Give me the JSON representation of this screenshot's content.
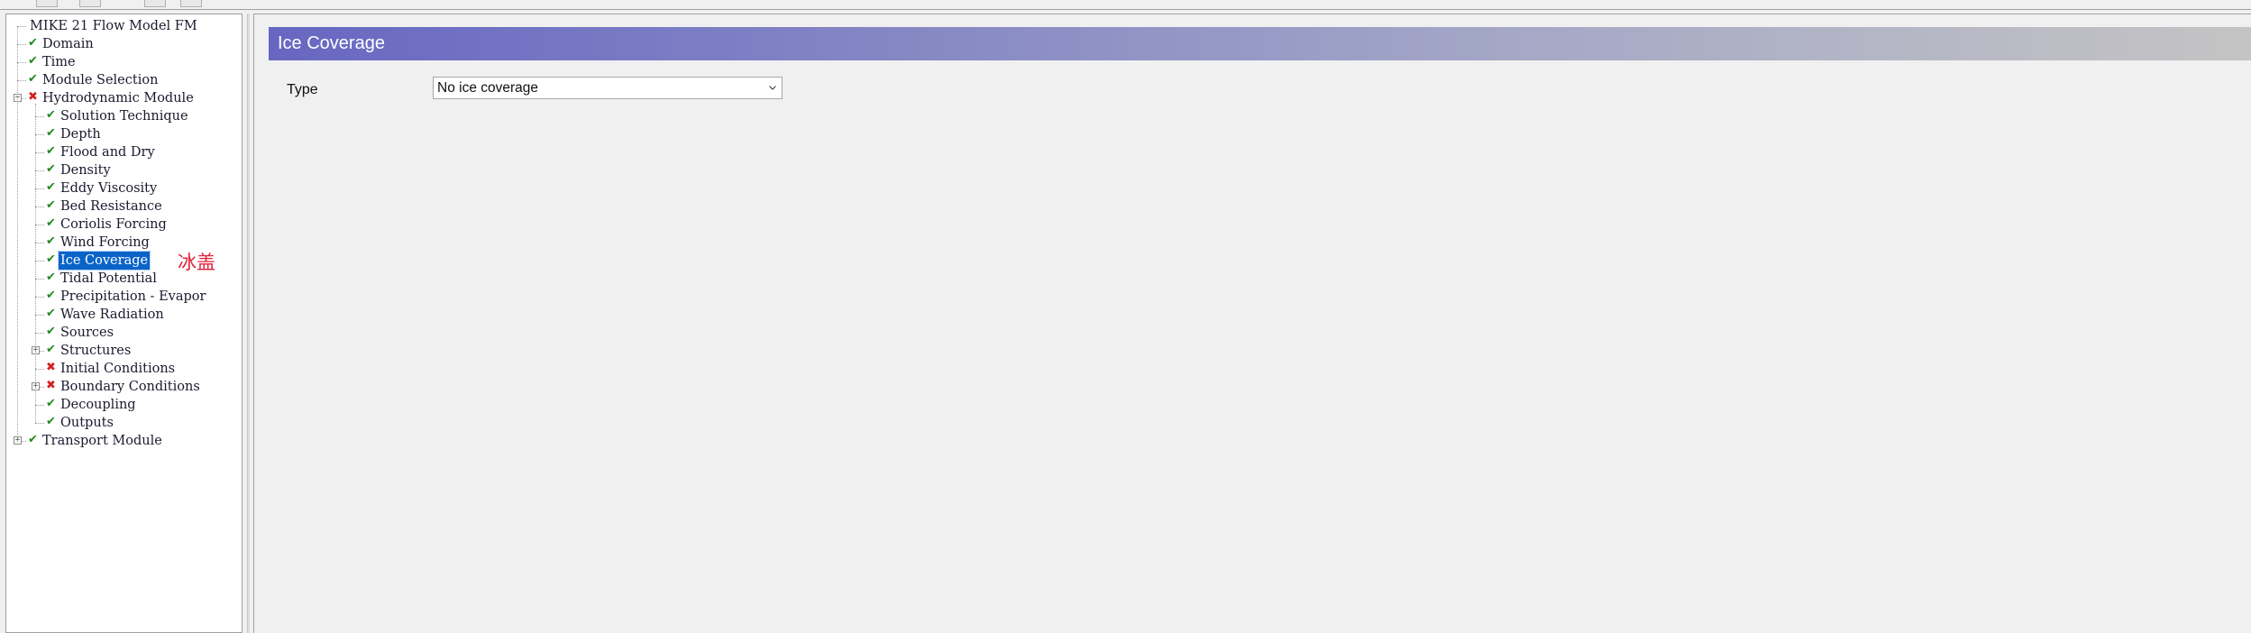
{
  "tree": {
    "items": [
      {
        "label": "MIKE 21 Flow Model FM",
        "status": "none",
        "expander": "none"
      },
      {
        "label": "Domain",
        "status": "ok",
        "expander": "none"
      },
      {
        "label": "Time",
        "status": "ok",
        "expander": "none"
      },
      {
        "label": "Module Selection",
        "status": "ok",
        "expander": "none"
      },
      {
        "label": "Hydrodynamic Module",
        "status": "error",
        "expander": "minus"
      },
      {
        "label": "Solution Technique",
        "status": "ok",
        "expander": "none"
      },
      {
        "label": "Depth",
        "status": "ok",
        "expander": "none"
      },
      {
        "label": "Flood and Dry",
        "status": "ok",
        "expander": "none"
      },
      {
        "label": "Density",
        "status": "ok",
        "expander": "none"
      },
      {
        "label": "Eddy Viscosity",
        "status": "ok",
        "expander": "none"
      },
      {
        "label": "Bed Resistance",
        "status": "ok",
        "expander": "none"
      },
      {
        "label": "Coriolis Forcing",
        "status": "ok",
        "expander": "none"
      },
      {
        "label": "Wind Forcing",
        "status": "ok",
        "expander": "none"
      },
      {
        "label": "Ice Coverage",
        "status": "ok",
        "expander": "none",
        "selected": true
      },
      {
        "label": "Tidal Potential",
        "status": "ok",
        "expander": "none"
      },
      {
        "label": "Precipitation - Evapor",
        "status": "ok",
        "expander": "none"
      },
      {
        "label": "Wave Radiation",
        "status": "ok",
        "expander": "none"
      },
      {
        "label": "Sources",
        "status": "ok",
        "expander": "none"
      },
      {
        "label": "Structures",
        "status": "ok",
        "expander": "plus"
      },
      {
        "label": "Initial Conditions",
        "status": "error",
        "expander": "none"
      },
      {
        "label": "Boundary Conditions",
        "status": "error",
        "expander": "plus"
      },
      {
        "label": "Decoupling",
        "status": "ok",
        "expander": "none"
      },
      {
        "label": "Outputs",
        "status": "ok",
        "expander": "none"
      },
      {
        "label": "Transport Module",
        "status": "ok",
        "expander": "plus"
      }
    ]
  },
  "annotation": "冰盖",
  "panel": {
    "title": "Ice Coverage",
    "type_label": "Type",
    "type_value": "No ice coverage"
  },
  "icons": {
    "ok": "check-icon",
    "error": "error-x-icon",
    "dropdown": "chevron-down-icon"
  },
  "colors": {
    "ok": "#1f8a1f",
    "error": "#d42020",
    "selection": "#0a64c8",
    "header_start": "#6767c2",
    "header_end": "#c4c4c4",
    "annotation": "#e0203a"
  }
}
